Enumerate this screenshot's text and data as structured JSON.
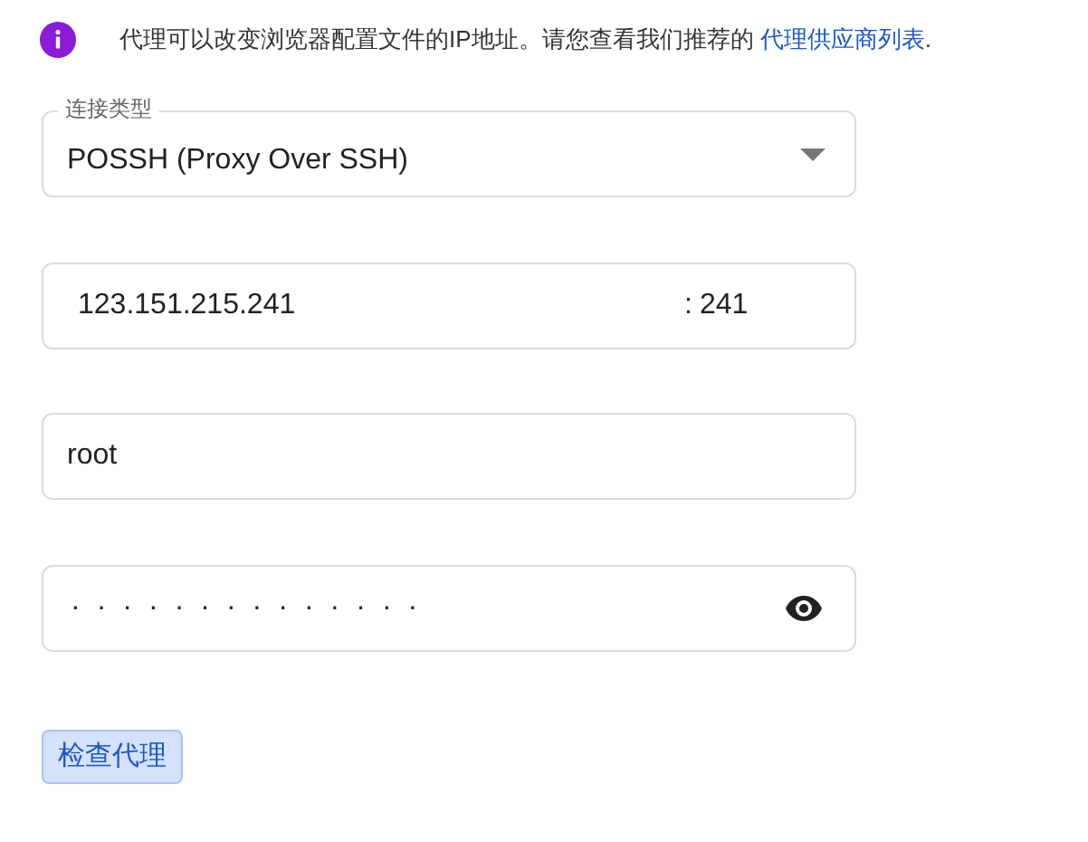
{
  "notice": {
    "text": "代理可以改变浏览器配置文件的IP地址。请您查看我们推荐的",
    "link": "代理供应商列表",
    "end": "."
  },
  "connection_type": {
    "label": "连接类型",
    "value": "POSSH (Proxy Over SSH)"
  },
  "host": {
    "value": "123.151.215.241",
    "separator": ":",
    "port": "241"
  },
  "username": {
    "value": "root"
  },
  "password": {
    "mask": "··············"
  },
  "buttons": [
    "检查代理"
  ]
}
